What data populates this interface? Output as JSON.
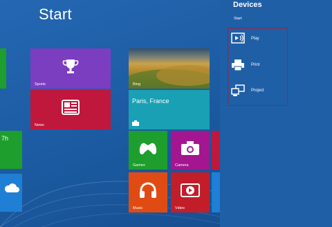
{
  "start": {
    "title": "Start",
    "tiles": {
      "sports": "Sports",
      "news": "News",
      "bing": "Bing",
      "weather_city": "Paris, France",
      "games": "Games",
      "camera": "Camera",
      "music": "Music",
      "video": "Video",
      "partial_label": "7h"
    }
  },
  "charm": {
    "title": "Devices",
    "subtitle": "Start",
    "devices": [
      {
        "label": "Play",
        "icon": "play-to-device-icon"
      },
      {
        "label": "Print",
        "icon": "printer-icon"
      },
      {
        "label": "Project",
        "icon": "project-display-icon"
      }
    ]
  },
  "colors": {
    "background": "#1d5fa6",
    "sports": "#7b3ec1",
    "news": "#c0173d",
    "weather": "#19a0b4",
    "games": "#1e9e2d",
    "camera": "#a3168f",
    "music": "#e04b14",
    "video": "#c21e2a",
    "highlight": "#c8102e"
  }
}
